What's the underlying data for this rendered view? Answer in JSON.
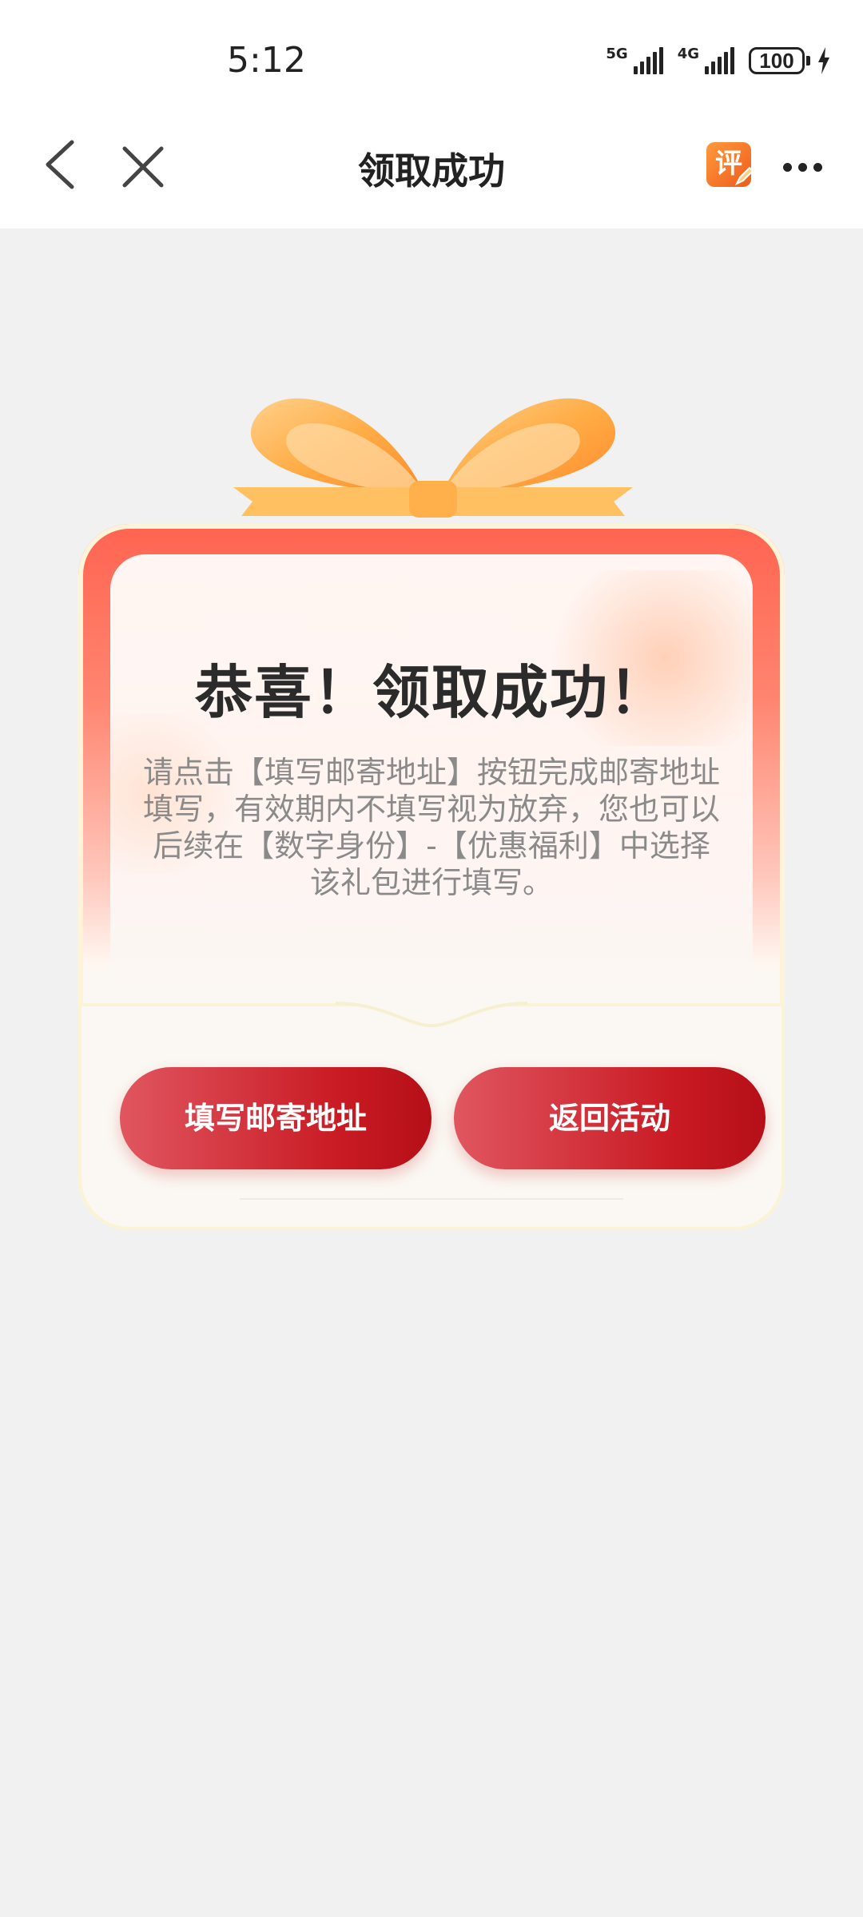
{
  "status_bar": {
    "time": "5:12",
    "signal1_label": "5G",
    "signal2_label": "4G",
    "battery": "100"
  },
  "nav": {
    "title": "领取成功",
    "review_icon_text": "评",
    "icons": [
      "back-icon",
      "close-icon",
      "review-icon",
      "more-icon"
    ]
  },
  "card": {
    "title": "恭喜！领取成功！",
    "description": "请点击【填写邮寄地址】按钮完成邮寄地址填写，有效期内不填写视为放弃，您也可以后续在【数字身份】-【优惠福利】中选择该礼包进行填写。",
    "buttons": {
      "fill_address": "填写邮寄地址",
      "back_to_activity": "返回活动"
    }
  },
  "colors": {
    "accent_red": "#c91b24",
    "background": "#f1f1f1",
    "ribbon": "#ffb04a"
  }
}
